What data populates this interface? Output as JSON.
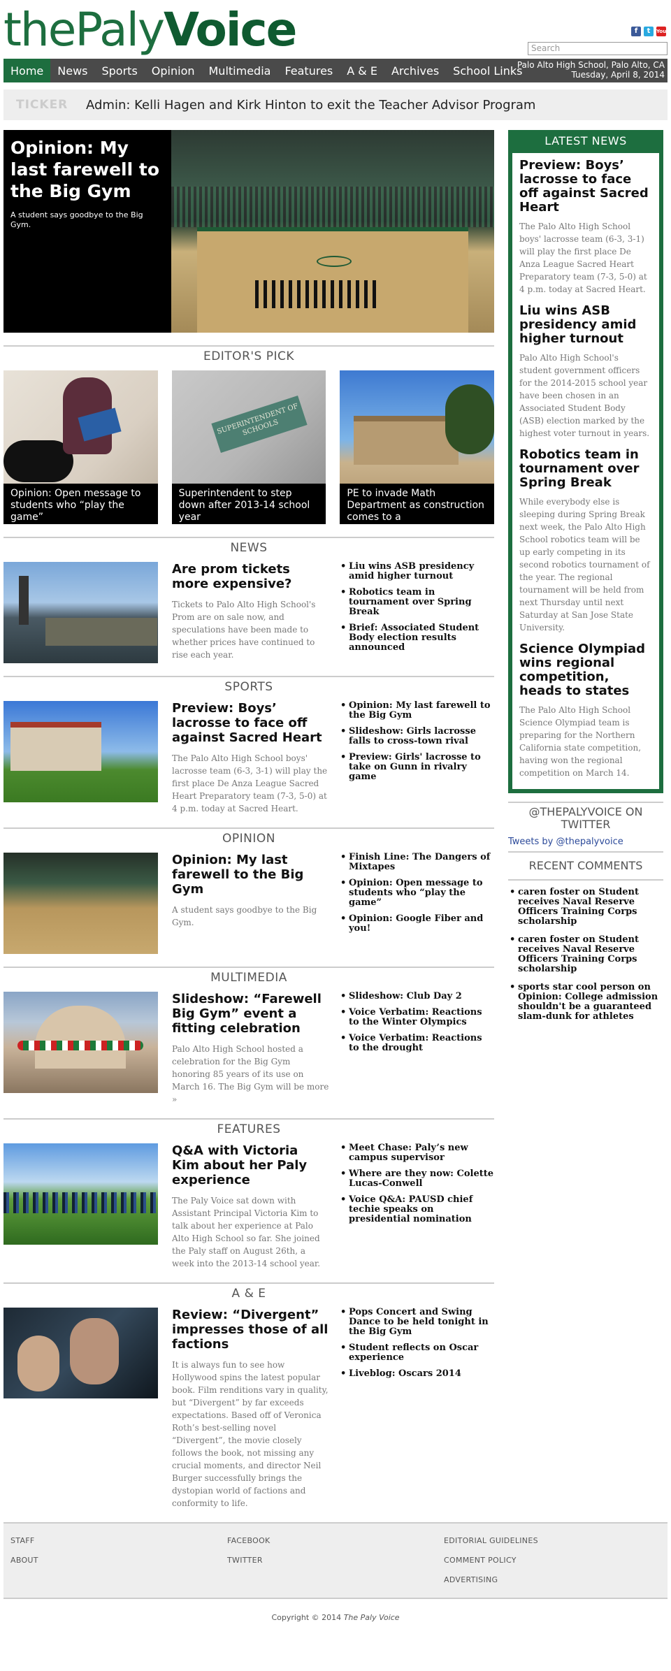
{
  "brand": {
    "part1": "the",
    "part2": "Paly",
    "part3": "Voice"
  },
  "social": {
    "facebook": "f",
    "twitter": "t",
    "youtube": "You"
  },
  "search": {
    "placeholder": "Search"
  },
  "nav": {
    "items": [
      "Home",
      "News",
      "Sports",
      "Opinion",
      "Multimedia",
      "Features",
      "A & E",
      "Archives",
      "School Links"
    ],
    "location": "Palo Alto High School, Palo Alto, CA",
    "date": "Tuesday, April 8, 2014"
  },
  "ticker": {
    "label": "TICKER",
    "text": "Admin: Kelli Hagen and Kirk Hinton to exit the Teacher Advisor Program"
  },
  "hero": {
    "title": "Opinion: My last farewell to the Big Gym",
    "dek": "A student says goodbye to the Big Gym."
  },
  "editors_pick": {
    "title": "EDITOR'S PICK",
    "items": [
      {
        "caption": "Opinion: Open message to students who “play the game”"
      },
      {
        "caption": "Superintendent to step down after 2013-14 school year"
      },
      {
        "caption": "PE to invade Math Department as construction comes to a"
      }
    ],
    "sign_text": "SUPERINTENDENT OF SCHOOLS"
  },
  "sections": [
    {
      "title": "NEWS",
      "headline": "Are prom tickets more expensive?",
      "excerpt": "Tickets to Palo Alto High School's Prom are on sale now, and speculations have been made to whether prices have continued to rise each year.",
      "more": "",
      "links": [
        "Liu wins ASB presidency amid higher turnout",
        "Robotics team in tournament over Spring Break",
        "Brief: Associated Student Body election results announced"
      ]
    },
    {
      "title": "SPORTS",
      "headline": "Preview: Boys’ lacrosse to face off against Sacred Heart",
      "excerpt": "The Palo Alto High School boys' lacrosse team (6-3, 3-1) will play the first place De Anza League Sacred Heart Preparatory team (7-3, 5-0) at 4 p.m. today at Sacred Heart.",
      "more": "",
      "links": [
        "Opinion: My last farewell to the Big Gym",
        "Slideshow: Girls lacrosse falls to cross-town rival",
        "Preview: Girls' lacrosse to take on Gunn in rivalry game"
      ]
    },
    {
      "title": "OPINION",
      "headline": "Opinion: My last farewell to the Big Gym",
      "excerpt": "A student says goodbye to the Big Gym.",
      "more": "",
      "links": [
        "Finish Line: The Dangers of Mixtapes",
        "Opinion: Open message to students who “play the game”",
        "Opinion: Google Fiber and you!"
      ]
    },
    {
      "title": "MULTIMEDIA",
      "headline": "Slideshow: “Farewell Big Gym” event a fitting celebration",
      "excerpt": "Palo Alto High School hosted a celebration for the Big Gym honoring 85 years of its use on March 16. The Big Gym will be",
      "more": "more »",
      "links": [
        "Slideshow: Club Day 2",
        "Voice Verbatim: Reactions to the Winter Olympics",
        "Voice Verbatim: Reactions to the drought"
      ]
    },
    {
      "title": "FEATURES",
      "headline": "Q&A with Victoria Kim about her Paly experience",
      "excerpt": "The Paly Voice sat down with Assistant Principal Victoria Kim to talk about her experience at Palo Alto High School so far. She joined the Paly staff on August 26th, a week into the 2013-14 school year.",
      "more": "",
      "links": [
        "Meet Chase: Paly’s new campus supervisor",
        "Where are they now: Colette Lucas-Conwell",
        "Voice Q&A: PAUSD chief techie speaks on presidential nomination"
      ]
    },
    {
      "title": "A & E",
      "headline": "Review: “Divergent” impresses those of all factions",
      "excerpt": "It is always fun to see how Hollywood spins the latest popular book. Film renditions vary in quality, but “Divergent” by far exceeds expectations. Based off of Veronica Roth’s best-selling novel “Divergent”, the movie closely follows the book, not missing any crucial moments, and director Neil Burger successfully brings the dystopian world of factions and conformity to life.",
      "more": "",
      "links": [
        "Pops Concert and Swing Dance to be held tonight in the Big Gym",
        "Student reflects on Oscar experience",
        "Liveblog: Oscars 2014"
      ]
    }
  ],
  "sidebar": {
    "latest_title": "LATEST NEWS",
    "latest": [
      {
        "title": "Preview: Boys’ lacrosse to face off against Sacred Heart",
        "text": "The Palo Alto High School boys' lacrosse team (6-3, 3-1) will play the first place De Anza League Sacred Heart Preparatory team (7-3, 5-0) at 4 p.m. today at Sacred Heart."
      },
      {
        "title": "Liu wins ASB presidency amid higher turnout",
        "text": "Palo Alto High School's student government officers for the 2014-2015 school year have been chosen in an Associated Student Body (ASB) election marked by the highest voter turnout in years."
      },
      {
        "title": "Robotics team in tournament over Spring Break",
        "text": "While everybody else is sleeping during Spring Break next week, the Palo Alto High School robotics team will be up early competing in its second robotics tournament of the year. The regional tournament will be held from next Thursday until next Saturday at San Jose State University."
      },
      {
        "title": "Science Olympiad wins regional competition, heads to states",
        "text": "The Palo Alto High School Science Olympiad team is preparing for the Northern California state competition, having won the regional competition on March 14."
      }
    ],
    "twitter_title": "@THEPALYVOICE ON TWITTER",
    "twitter_link": "Tweets by @thepalyvoice",
    "comments_title": "RECENT COMMENTS",
    "comments": [
      "caren foster on Student receives Naval Reserve Officers Training Corps scholarship",
      "caren foster on Student receives Naval Reserve Officers Training Corps scholarship",
      "sports star cool person on Opinion: College admission shouldn't be a guaranteed slam-dunk for athletes"
    ]
  },
  "footer": {
    "col1": [
      "STAFF",
      "ABOUT"
    ],
    "col2": [
      "FACEBOOK",
      "TWITTER"
    ],
    "col3": [
      "EDITORIAL GUIDELINES",
      "COMMENT POLICY",
      "ADVERTISING"
    ],
    "copyright_prefix": "Copyright © 2014",
    "copyright_name": "The Paly Voice"
  }
}
